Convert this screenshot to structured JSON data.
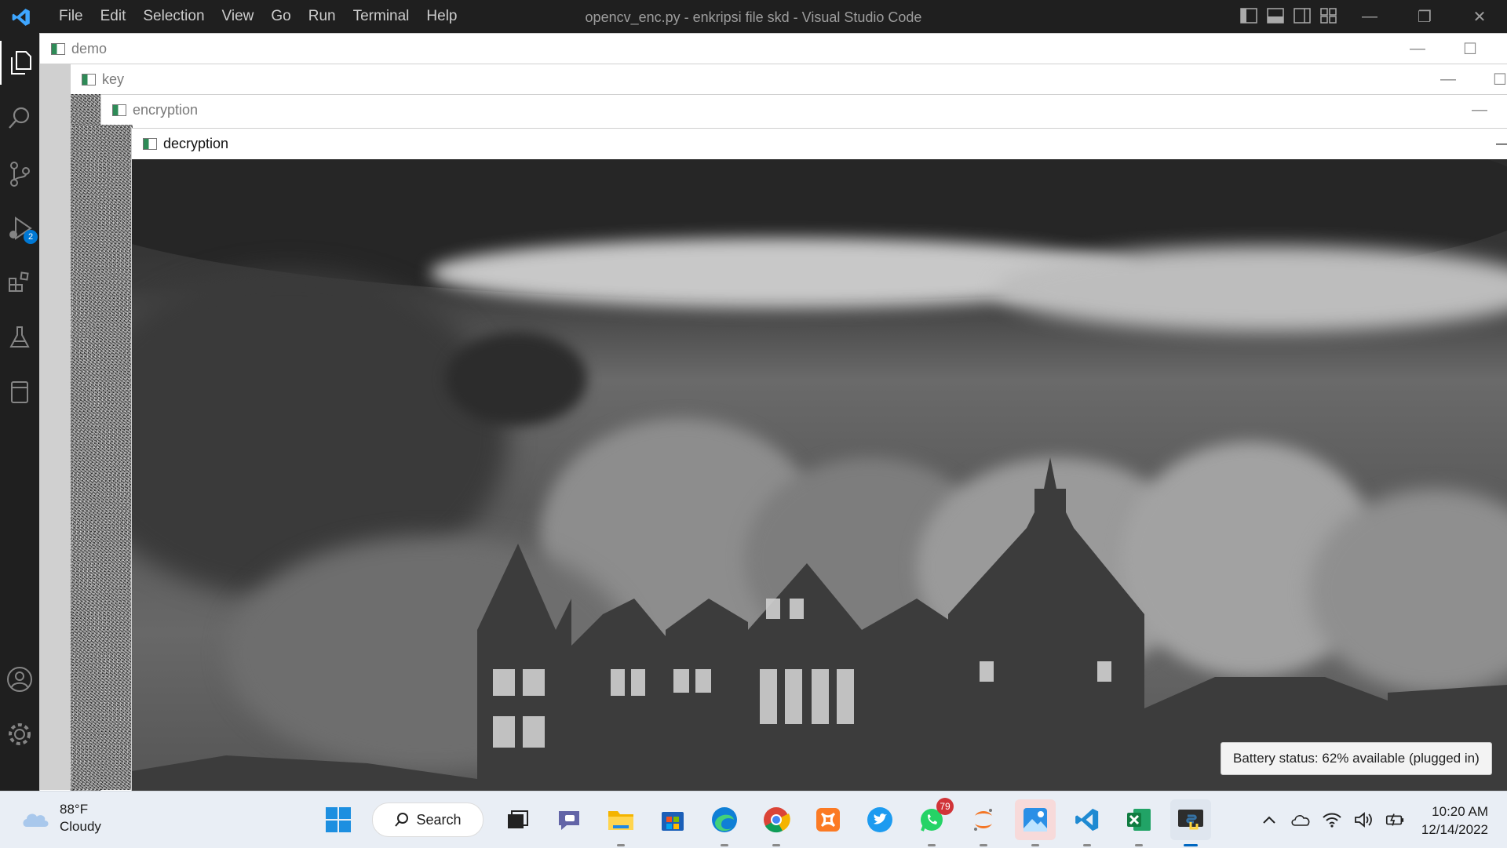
{
  "vscode": {
    "window_title": "opencv_enc.py - enkripsi file skd - Visual Studio Code",
    "menu": [
      "File",
      "Edit",
      "Selection",
      "View",
      "Go",
      "Run",
      "Terminal",
      "Help"
    ],
    "debug_badge": "2",
    "window_controls": {
      "minimize": "—",
      "restore": "❐",
      "close": "✕"
    }
  },
  "opencv_windows": [
    {
      "title": "demo",
      "minimize": "—",
      "maximize": "☐"
    },
    {
      "title": "key",
      "minimize": "—",
      "maximize": "☐"
    },
    {
      "title": "encryption",
      "minimize": "—"
    },
    {
      "title": "decryption",
      "minimize": "—"
    }
  ],
  "tooltip": "Battery status: 62% available (plugged in)",
  "taskbar": {
    "weather": {
      "temp": "88°F",
      "condition": "Cloudy"
    },
    "search_label": "Search",
    "whatsapp_badge": "79",
    "clock": {
      "time": "10:20 AM",
      "date": "12/14/2022"
    },
    "icons": [
      "start-icon",
      "task-view-icon",
      "teams-chat-icon",
      "file-explorer-icon",
      "microsoft-store-icon",
      "edge-icon",
      "chrome-icon",
      "xampp-icon",
      "twitter-icon",
      "whatsapp-icon",
      "jupyter-icon",
      "photos-icon",
      "vscode-icon",
      "excel-icon",
      "python-icon"
    ]
  },
  "colors": {
    "vscode_bg": "#1f1f1f",
    "accent": "#0078d4",
    "remote": "#e2591e",
    "taskbar": "#e9eef5"
  }
}
